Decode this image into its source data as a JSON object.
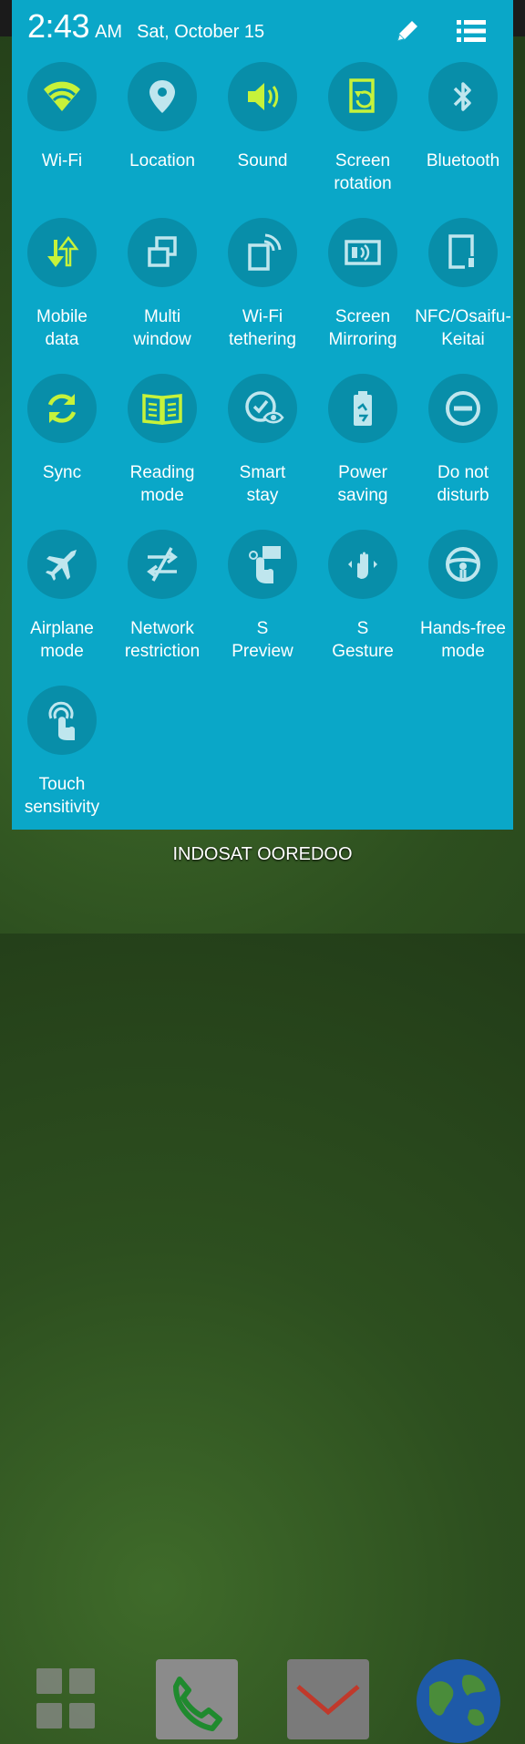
{
  "status": {
    "time": "2:43",
    "ampm": "AM",
    "date": "Sat, October 15"
  },
  "header_icons": [
    "edit-icon",
    "list-icon"
  ],
  "colors": {
    "panel": "#0aa7c8",
    "circle": "#088ea9",
    "active_icon": "#c6f23a",
    "inactive_icon": "#bfe6ee"
  },
  "tiles": [
    {
      "label": "Wi-Fi",
      "icon": "wifi-icon",
      "active": true
    },
    {
      "label": "Location",
      "icon": "location-icon",
      "active": false
    },
    {
      "label": "Sound",
      "icon": "sound-icon",
      "active": true
    },
    {
      "label": "Screen\nrotation",
      "icon": "screen-rotation-icon",
      "active": true
    },
    {
      "label": "Bluetooth",
      "icon": "bluetooth-icon",
      "active": false
    },
    {
      "label": "Mobile\ndata",
      "icon": "mobile-data-icon",
      "active": true
    },
    {
      "label": "Multi\nwindow",
      "icon": "multi-window-icon",
      "active": false
    },
    {
      "label": "Wi-Fi\ntethering",
      "icon": "wifi-tethering-icon",
      "active": false
    },
    {
      "label": "Screen\nMirroring",
      "icon": "screen-mirroring-icon",
      "active": false
    },
    {
      "label": "NFC/Osaifu-\nKeitai",
      "icon": "nfc-icon",
      "active": false
    },
    {
      "label": "Sync",
      "icon": "sync-icon",
      "active": true
    },
    {
      "label": "Reading\nmode",
      "icon": "reading-mode-icon",
      "active": true
    },
    {
      "label": "Smart\nstay",
      "icon": "smart-stay-icon",
      "active": false
    },
    {
      "label": "Power\nsaving",
      "icon": "power-saving-icon",
      "active": false
    },
    {
      "label": "Do not\ndisturb",
      "icon": "do-not-disturb-icon",
      "active": false
    },
    {
      "label": "Airplane\nmode",
      "icon": "airplane-icon",
      "active": false
    },
    {
      "label": "Network\nrestriction",
      "icon": "network-restriction-icon",
      "active": false
    },
    {
      "label": "S\nPreview",
      "icon": "s-preview-icon",
      "active": false
    },
    {
      "label": "S\nGesture",
      "icon": "s-gesture-icon",
      "active": false
    },
    {
      "label": "Hands-free\nmode",
      "icon": "hands-free-icon",
      "active": false
    },
    {
      "label": "Touch\nsensitivity",
      "icon": "touch-sensitivity-icon",
      "active": false
    }
  ],
  "dock": {
    "carrier": "INDOSAT OOREDOO",
    "apps": [
      "apps-grid-icon",
      "phone-icon",
      "email-icon",
      "globe-icon"
    ]
  }
}
